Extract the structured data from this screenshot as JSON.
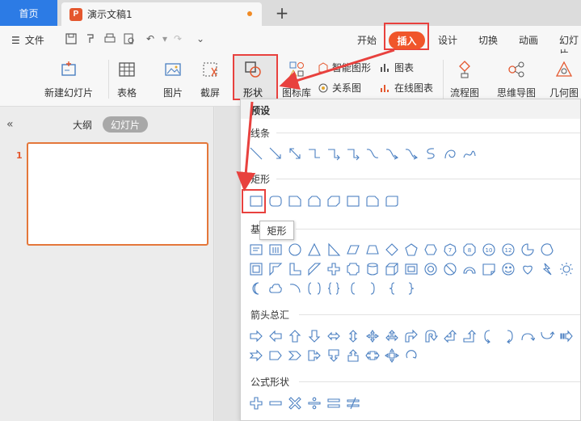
{
  "tabs": {
    "home": "首页",
    "document": "演示文稿1",
    "new_tab": "+"
  },
  "menubar": {
    "file": "文件",
    "items": [
      "开始",
      "插入",
      "设计",
      "切换",
      "动画",
      "幻灯片"
    ],
    "active": "插入"
  },
  "ribbon": {
    "new_slide": "新建幻灯片",
    "table": "表格",
    "image": "图片",
    "screenshot": "截屏",
    "shape": "形状",
    "icon_lib": "图标库",
    "smart_graphic": "智能图形",
    "relation_graph": "关系图",
    "chart": "图表",
    "online_chart": "在线图表",
    "flowchart": "流程图",
    "mindmap": "思维导图",
    "geometry": "几何图"
  },
  "left_pane": {
    "outline": "大纲",
    "slides": "幻灯片",
    "slide_number": "1"
  },
  "shape_menu": {
    "header": "预设",
    "sections": {
      "lines": "线条",
      "rectangles": "矩形",
      "basic": "基",
      "arrows": "箭头总汇",
      "formula": "公式形状"
    },
    "tooltip": "矩形"
  },
  "colors": {
    "accent": "#f0562b",
    "highlight": "#e8413e",
    "home_tab": "#2c7be5",
    "shape_stroke": "#4a7fc1"
  }
}
